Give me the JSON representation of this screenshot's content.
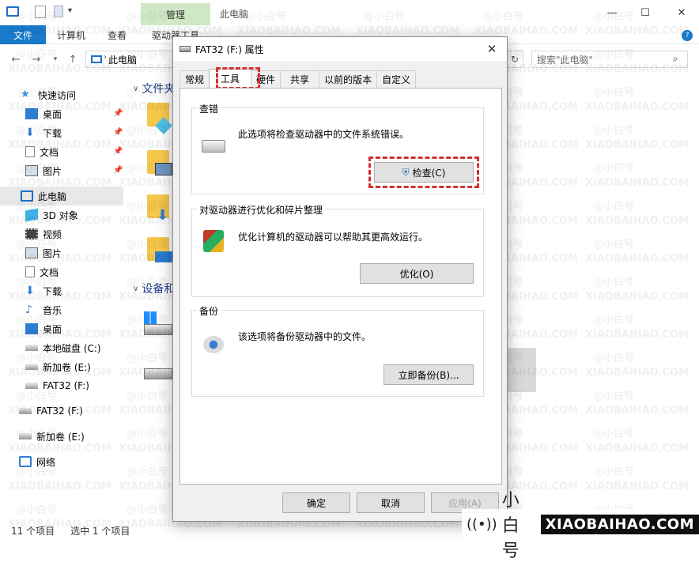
{
  "explorer": {
    "ribbon": {
      "manage_label": "管理",
      "window_title": "此电脑",
      "tabs": [
        "文件",
        "计算机",
        "查看",
        "驱动器工具"
      ]
    },
    "address": {
      "path": "此电脑",
      "search_placeholder": "搜索\"此电脑\""
    },
    "sidebar": {
      "items": [
        {
          "label": "快速访问",
          "icon": "star-icon"
        },
        {
          "label": "桌面",
          "icon": "desktop-icon"
        },
        {
          "label": "下载",
          "icon": "download-icon"
        },
        {
          "label": "文档",
          "icon": "document-icon"
        },
        {
          "label": "图片",
          "icon": "picture-icon"
        },
        {
          "label": "此电脑",
          "icon": "computer-icon"
        },
        {
          "label": "3D 对象",
          "icon": "cube-icon"
        },
        {
          "label": "视频",
          "icon": "video-icon"
        },
        {
          "label": "图片",
          "icon": "picture-icon"
        },
        {
          "label": "文档",
          "icon": "document-icon"
        },
        {
          "label": "下载",
          "icon": "download-icon"
        },
        {
          "label": "音乐",
          "icon": "music-icon"
        },
        {
          "label": "桌面",
          "icon": "desktop-icon"
        },
        {
          "label": "本地磁盘 (C:)",
          "icon": "drive-icon"
        },
        {
          "label": "新加卷 (E:)",
          "icon": "drive-icon"
        },
        {
          "label": "FAT32 (F:)",
          "icon": "drive-icon"
        },
        {
          "label": "FAT32 (F:)",
          "icon": "drive-icon"
        },
        {
          "label": "新加卷 (E:)",
          "icon": "drive-icon"
        },
        {
          "label": "网络",
          "icon": "network-icon"
        }
      ]
    },
    "main": {
      "section_folders": "文件夹",
      "section_devices": "设备和"
    },
    "status": {
      "count": "11 个项目",
      "selected": "选中 1 个项目"
    }
  },
  "dialog": {
    "title": "FAT32 (F:) 属性",
    "tabs": [
      "常规",
      "工具",
      "硬件",
      "共享",
      "以前的版本",
      "自定义"
    ],
    "active_tab": "工具",
    "error_check": {
      "title": "查错",
      "desc": "此选项将检查驱动器中的文件系统错误。",
      "button": "检查(C)"
    },
    "optimize": {
      "title": "对驱动器进行优化和碎片整理",
      "desc": "优化计算机的驱动器可以帮助其更高效运行。",
      "button": "优化(O)"
    },
    "backup": {
      "title": "备份",
      "desc": "该选项将备份驱动器中的文件。",
      "button": "立即备份(B)..."
    },
    "footer": {
      "ok": "确定",
      "cancel": "取消",
      "apply": "应用(A)"
    }
  },
  "watermark": {
    "cn": "@小白号",
    "en": "XIAOBAIHAO.COM",
    "brand_cn": "小白号",
    "brand_en": "XIAOBAIHAO.COM"
  },
  "colors": {
    "file_tab": "#1979ca",
    "manage_tab": "#cfe8c5",
    "highlight": "#d32f2f",
    "folder": "#f5c84c"
  }
}
